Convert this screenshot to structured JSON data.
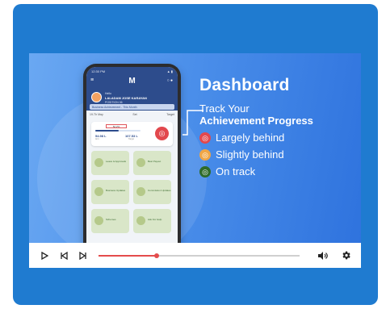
{
  "colors": {
    "frame": "#1f7bd0",
    "accent_red": "#e44c4c",
    "largely_behind": "#e2484d",
    "slightly_behind": "#f0a645",
    "on_track": "#2e6b2a"
  },
  "slide": {
    "title": "Dashboard",
    "track_line1": "Track Your",
    "track_line2": "Achievement Progress",
    "legend": [
      {
        "label": "Largely behind",
        "color": "#e2484d",
        "icon": "target-icon"
      },
      {
        "label": "Slightly behind",
        "color": "#f0a645",
        "icon": "target-icon"
      },
      {
        "label": "On track",
        "color": "#2e6b2a",
        "icon": "target-icon"
      }
    ]
  },
  "phone": {
    "time": "12:30 PM",
    "logo": "M",
    "greeting": "Hello",
    "name": "LALADAM JOSE KARAYAN",
    "role": "POSITION 06",
    "banner": "Business Achievement - This Month",
    "filter_left": "19-Th May",
    "filter_mid": "Set",
    "filter_right": "Target",
    "achievement_pct": "52.2%",
    "achieved_value": "54.98 L",
    "achieved_label": "Amt",
    "target_value": "107.53 L",
    "target_label": "Target",
    "tiles": [
      {
        "label": "Leave & Approvals"
      },
      {
        "label": "Best Payout"
      },
      {
        "label": "Business Updates"
      },
      {
        "label": "Commission Updates"
      },
      {
        "label": "Schemes"
      },
      {
        "label": "Ask For Help"
      }
    ]
  },
  "player": {
    "progress": 0.29
  }
}
